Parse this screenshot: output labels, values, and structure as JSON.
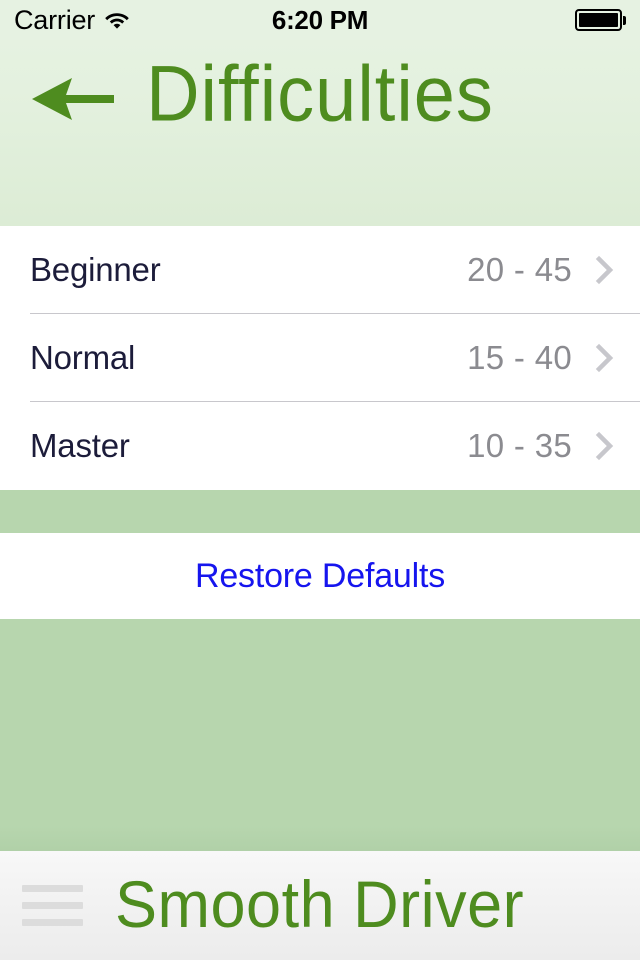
{
  "status_bar": {
    "carrier": "Carrier",
    "wifi_icon": "wifi-icon",
    "time": "6:20 PM",
    "battery_icon": "battery-full-icon"
  },
  "header": {
    "title": "Difficulties",
    "back_icon": "back-arrow-icon",
    "accent_color": "#4e8c1f",
    "background_color": "#e4f1df"
  },
  "table": {
    "rows": [
      {
        "label": "Beginner",
        "value": "20 - 45",
        "chevron": "chevron-right-icon"
      },
      {
        "label": "Normal",
        "value": "15 - 40",
        "chevron": "chevron-right-icon"
      },
      {
        "label": "Master",
        "value": "10 - 35",
        "chevron": "chevron-right-icon"
      }
    ]
  },
  "restore": {
    "label": "Restore Defaults",
    "color": "#1615ee"
  },
  "bottom_bar": {
    "menu_icon": "hamburger-menu-icon",
    "app_name": "Smooth Driver"
  },
  "colors": {
    "page_background": "#b7d6ae",
    "row_background": "#ffffff",
    "row_label": "#1c1c3a",
    "row_value": "#8b8b90",
    "separator": "#c8c7cc"
  }
}
